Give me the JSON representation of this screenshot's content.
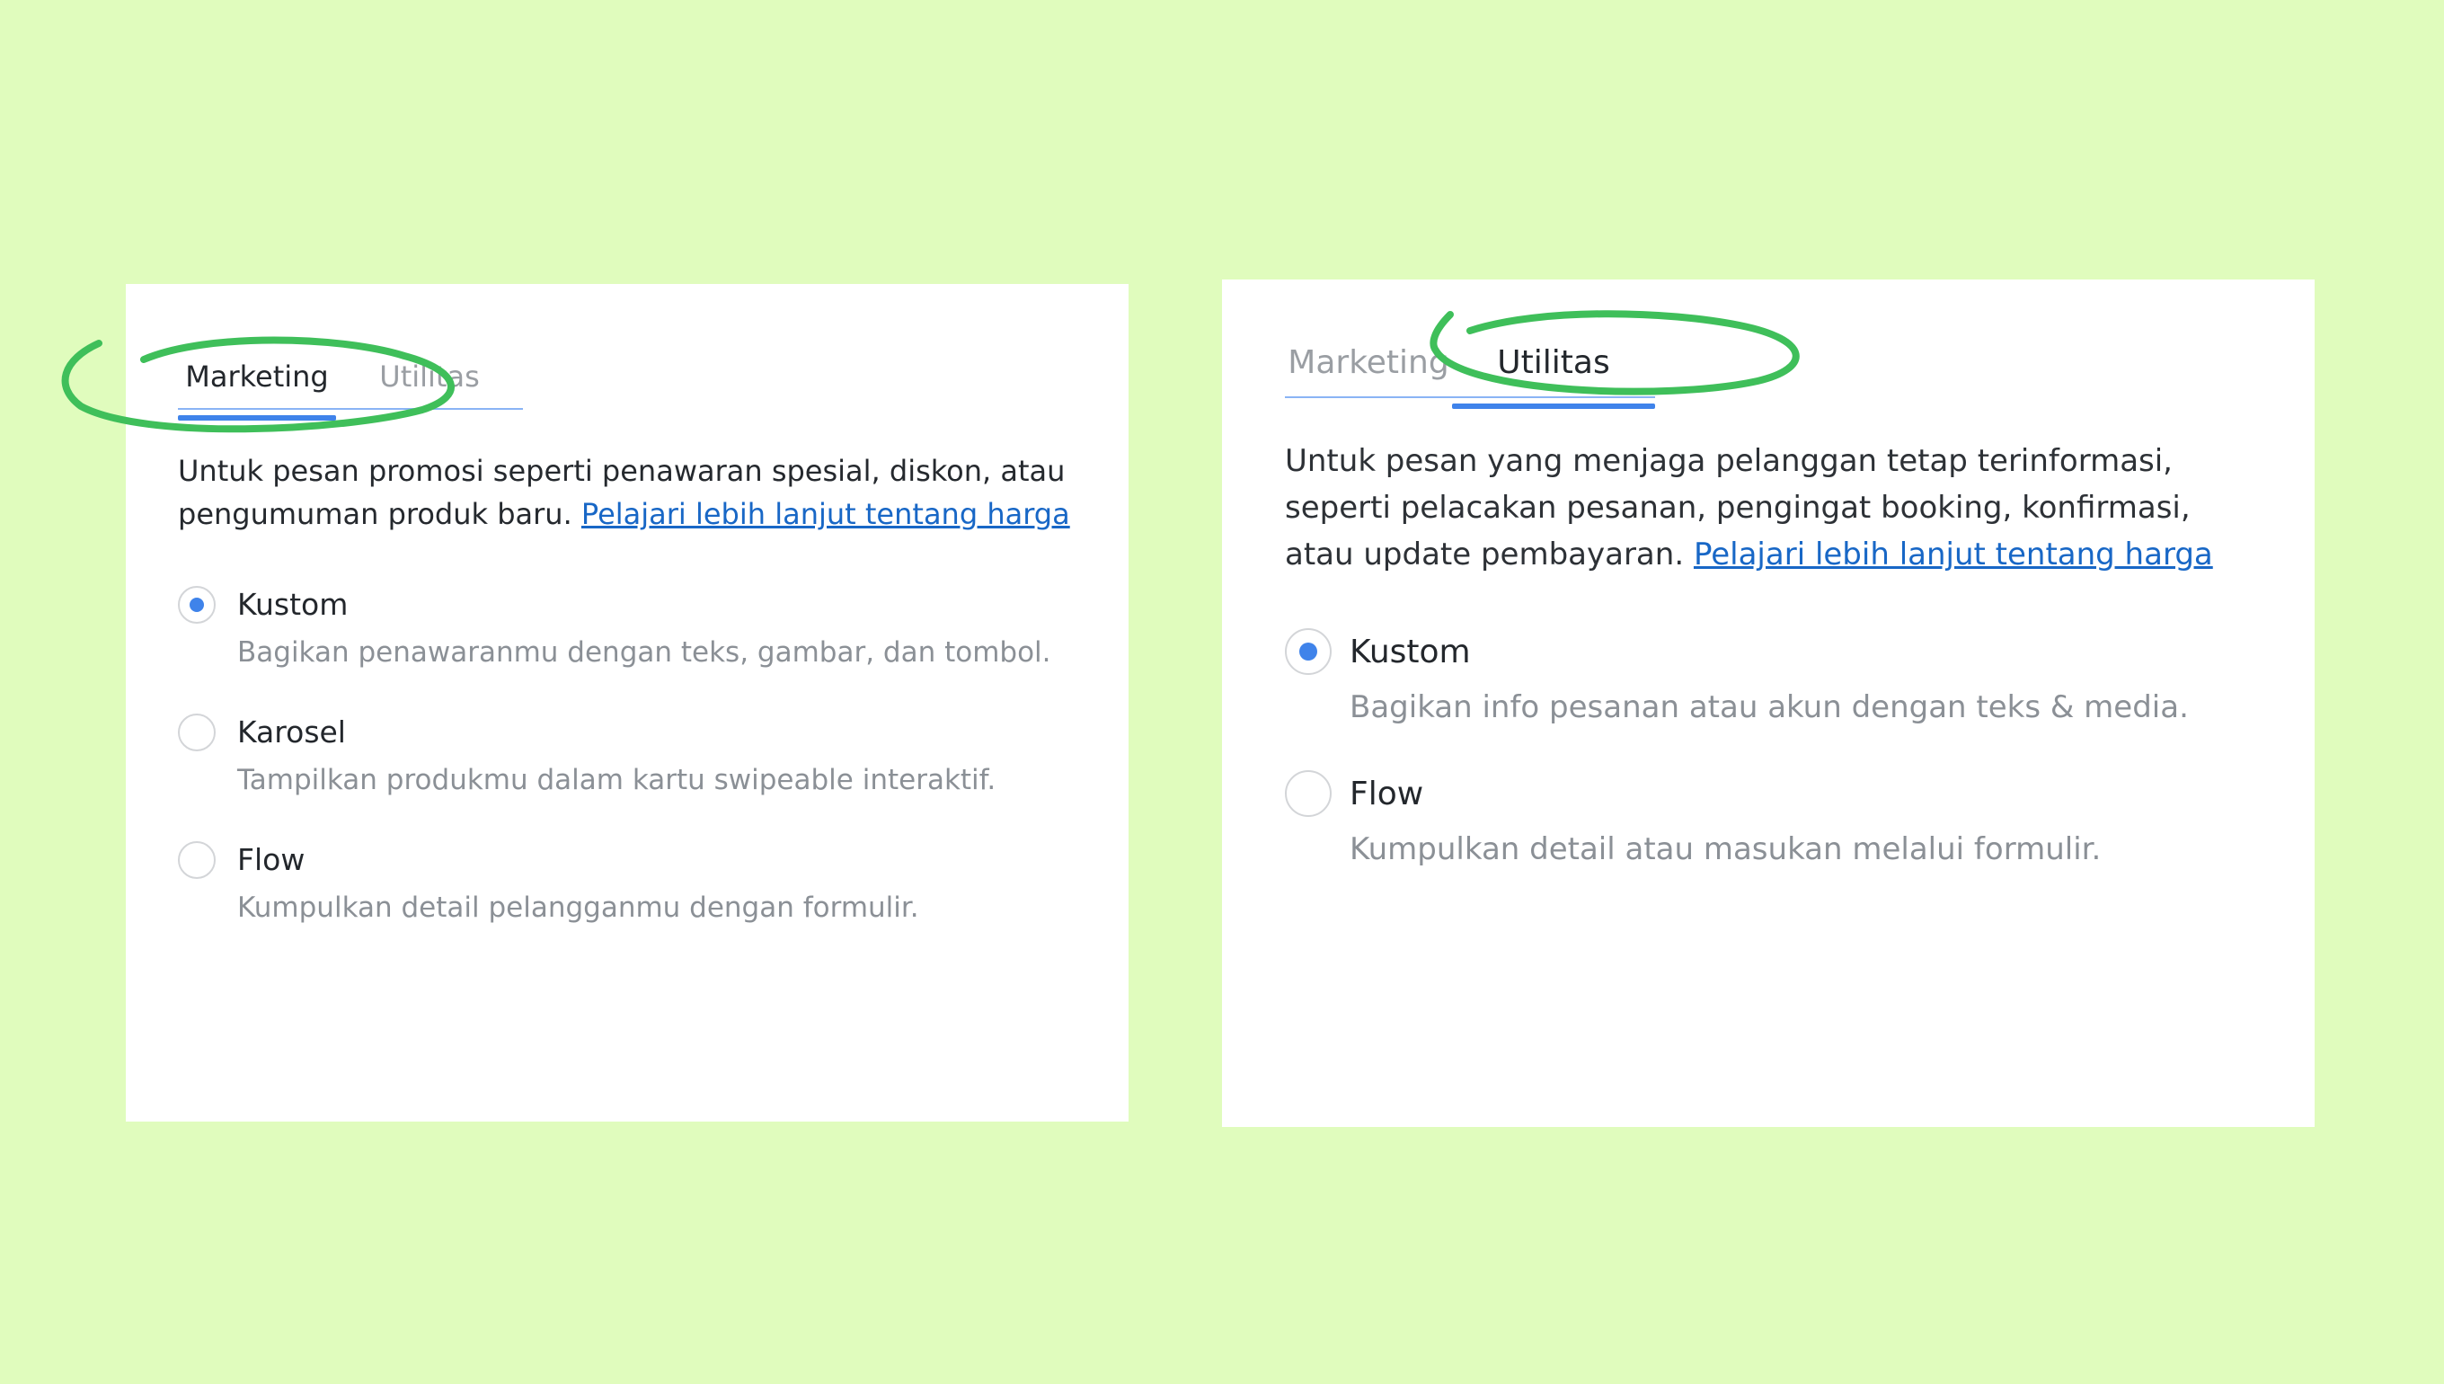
{
  "panels": [
    {
      "tabs": [
        {
          "label": "Marketing",
          "active": true
        },
        {
          "label": "Utilitas",
          "active": false
        }
      ],
      "description": "Untuk pesan promosi seperti penawaran spesial, diskon, atau pengumuman produk baru.",
      "link": "Pelajari lebih lanjut tentang harga",
      "options": [
        {
          "title": "Kustom",
          "subtitle": "Bagikan penawaranmu dengan teks, gambar, dan tombol.",
          "selected": true
        },
        {
          "title": "Karosel",
          "subtitle": "Tampilkan produkmu dalam kartu swipeable interaktif.",
          "selected": false
        },
        {
          "title": "Flow",
          "subtitle": "Kumpulkan detail pelangganmu dengan formulir.",
          "selected": false
        }
      ]
    },
    {
      "tabs": [
        {
          "label": "Marketing",
          "active": false
        },
        {
          "label": "Utilitas",
          "active": true
        }
      ],
      "description": "Untuk pesan yang menjaga pelanggan tetap terinformasi, seperti pelacakan pesanan, pengingat booking, konfirmasi, atau update pembayaran.",
      "link": "Pelajari lebih lanjut tentang harga",
      "options": [
        {
          "title": "Kustom",
          "subtitle": "Bagikan info pesanan atau akun dengan teks & media.",
          "selected": true
        },
        {
          "title": "Flow",
          "subtitle": "Kumpulkan detail atau masukan melalui formulir.",
          "selected": false
        }
      ]
    }
  ],
  "colors": {
    "background": "#e0fcbd",
    "highlight_loop": "#3fbf5a",
    "accent": "#3f83ea",
    "link": "#1867c6"
  }
}
